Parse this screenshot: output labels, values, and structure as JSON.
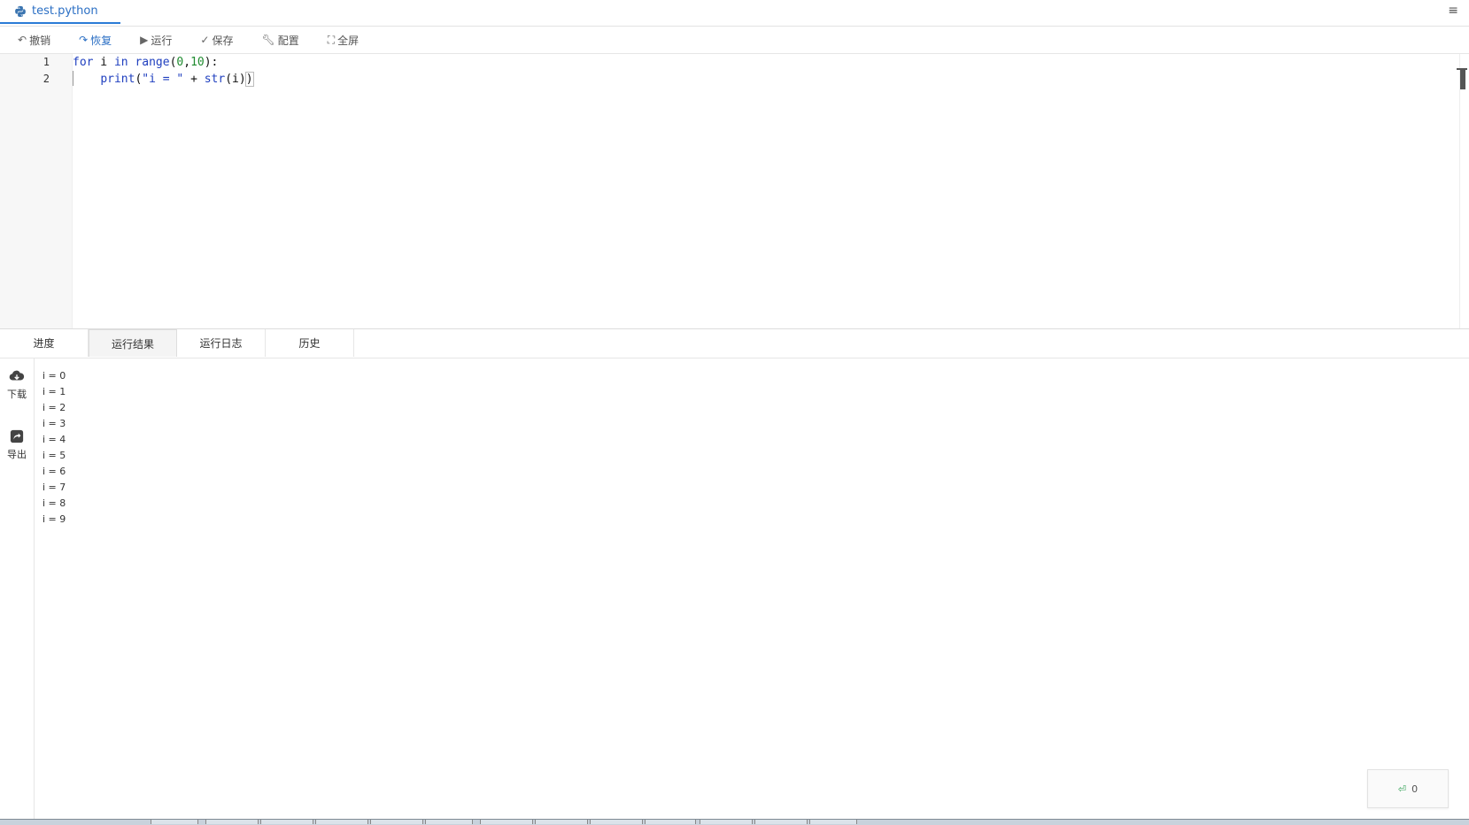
{
  "tab": {
    "filename": "test.python"
  },
  "toolbar": {
    "undo": "撤销",
    "redo": "恢复",
    "run": "运行",
    "save": "保存",
    "config": "配置",
    "fullscreen": "全屏"
  },
  "editor": {
    "line_numbers": [
      "1",
      "2"
    ],
    "lines": [
      {
        "kw": "for",
        "rest1": " i ",
        "kw2": "in",
        "rest2": " ",
        "fn": "range",
        "open": "(",
        "n1": "0",
        "comma": ",",
        "n2": "10",
        "close": "):"
      },
      {
        "indent": "    ",
        "fn": "print",
        "open": "(",
        "str": "\"i = \"",
        "plus": " + ",
        "fn2": "str",
        "arg": "(i)",
        "close": ")"
      }
    ]
  },
  "panel_tabs": [
    "进度",
    "运行结果",
    "运行日志",
    "历史"
  ],
  "active_panel_tab": "运行结果",
  "side": {
    "download": "下载",
    "export": "导出"
  },
  "output": [
    "i = 0",
    "i = 1",
    "i = 2",
    "i = 3",
    "i = 4",
    "i = 5",
    "i = 6",
    "i = 7",
    "i = 8",
    "i = 9"
  ],
  "counter": {
    "value": "0"
  },
  "colors": {
    "accent": "#2b6fc4",
    "keyword": "#1f3fbf",
    "number": "#1f8b2f"
  }
}
